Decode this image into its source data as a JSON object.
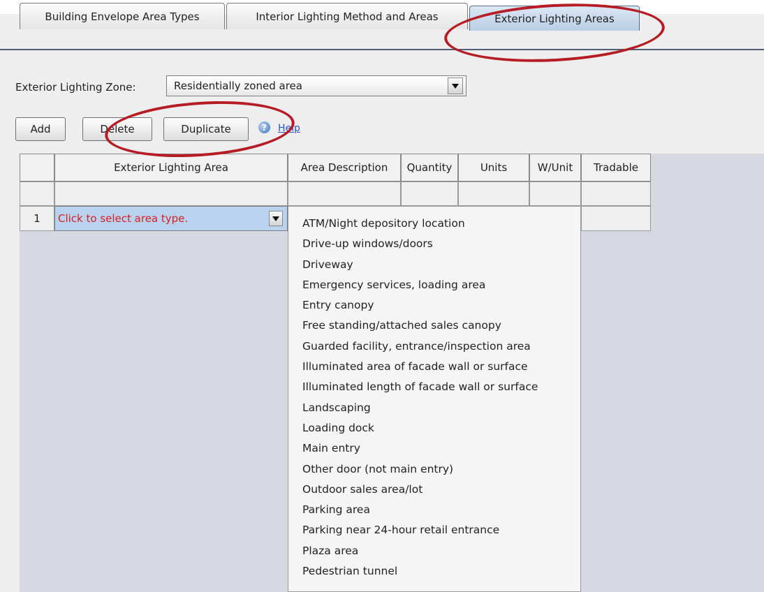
{
  "tabs": [
    {
      "label": "Building Envelope Area Types",
      "active": false
    },
    {
      "label": "Interior Lighting Method and Areas",
      "active": false
    },
    {
      "label": "Exterior Lighting Areas",
      "active": true
    }
  ],
  "zone": {
    "label": "Exterior Lighting Zone:",
    "value": "Residentially zoned area"
  },
  "buttons": {
    "add": "Add",
    "delete": "Delete",
    "duplicate": "Duplicate"
  },
  "help": {
    "label": "Help"
  },
  "table": {
    "columns": [
      "Exterior Lighting Area",
      "Area Description",
      "Quantity",
      "Units",
      "W/Unit",
      "Tradable"
    ],
    "rows": [
      {
        "num": "1",
        "area": "Click to select area type."
      }
    ]
  },
  "dropdown": {
    "items": [
      "ATM/Night depository location",
      "Drive-up windows/doors",
      "Driveway",
      "Emergency services, loading area",
      "Entry canopy",
      "Free standing/attached sales canopy",
      "Guarded facility, entrance/inspection area",
      "Illuminated area of facade wall or surface",
      "Illuminated length of facade wall or surface",
      "Landscaping",
      "Loading dock",
      "Main entry",
      "Other door (not main entry)",
      "Outdoor sales area/lot",
      "Parking area",
      "Parking near 24-hour retail entrance",
      "Plaza area",
      "Pedestrian tunnel"
    ]
  },
  "colors": {
    "accent": "#b51c24",
    "selected_cell": "#b8d2f0",
    "prompt_text": "#d62020",
    "link": "#2a56c6"
  }
}
